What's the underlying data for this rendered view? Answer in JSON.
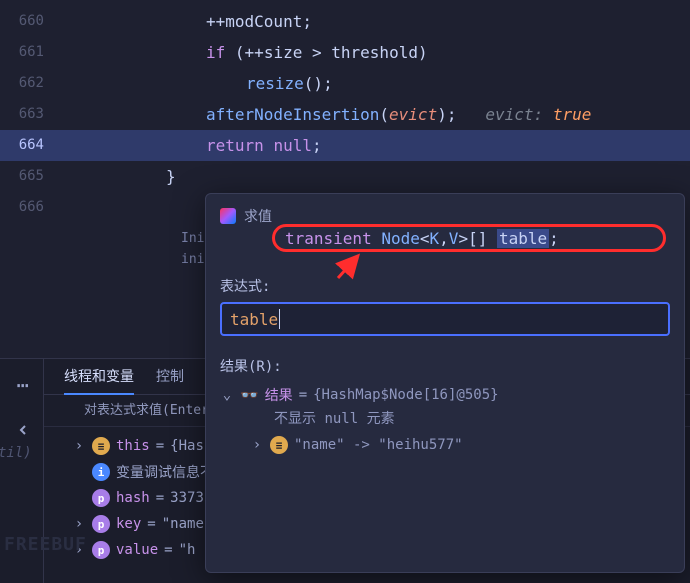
{
  "gutter": [
    "660",
    "661",
    "662",
    "663",
    "664",
    "665",
    "666"
  ],
  "code": {
    "l660_modCount": "modCount",
    "l661_if": "if",
    "l661_size": "size",
    "l661_threshold": "threshold",
    "l662_resize": "resize",
    "l663_fn": "afterNodeInsertion",
    "l663_arg": "evict",
    "l663_c1": "evict:",
    "l663_c2": "true",
    "l664_return": "return",
    "l664_null": "null",
    "l666_a": "Ini",
    "l666_b": "ini"
  },
  "debug": {
    "tab1": "线程和变量",
    "tab2": "控制",
    "eval_prompt": "对表达式求值(Enter",
    "vars": {
      "this_name": "this",
      "this_val": "{Has",
      "info": "变量调试信息不",
      "hash_name": "hash",
      "hash_val": "3373",
      "key_name": "key",
      "key_val": "\"name",
      "value_name": "value",
      "value_val": "\"h"
    },
    "left_label": "til)",
    "watermark": "FREEBUF"
  },
  "popup": {
    "title": "求值",
    "annot_transient": "transient",
    "annot_type": "Node",
    "annot_gen_open": "<",
    "annot_K": "K",
    "annot_comma": ", ",
    "annot_V": "V",
    "annot_gen_close": ">",
    "annot_brackets": "[]",
    "annot_table": "table",
    "annot_semi": ";",
    "expr_label": "表达式:",
    "expr_value": "table",
    "result_label": "结果(R):",
    "result_name": "结果",
    "result_val": "{HashMap$Node[16]@505}",
    "result_sub1": "不显示",
    "result_sub_null": "null",
    "result_sub2": "元素",
    "result_entry": "\"name\" -> \"heihu577\""
  }
}
